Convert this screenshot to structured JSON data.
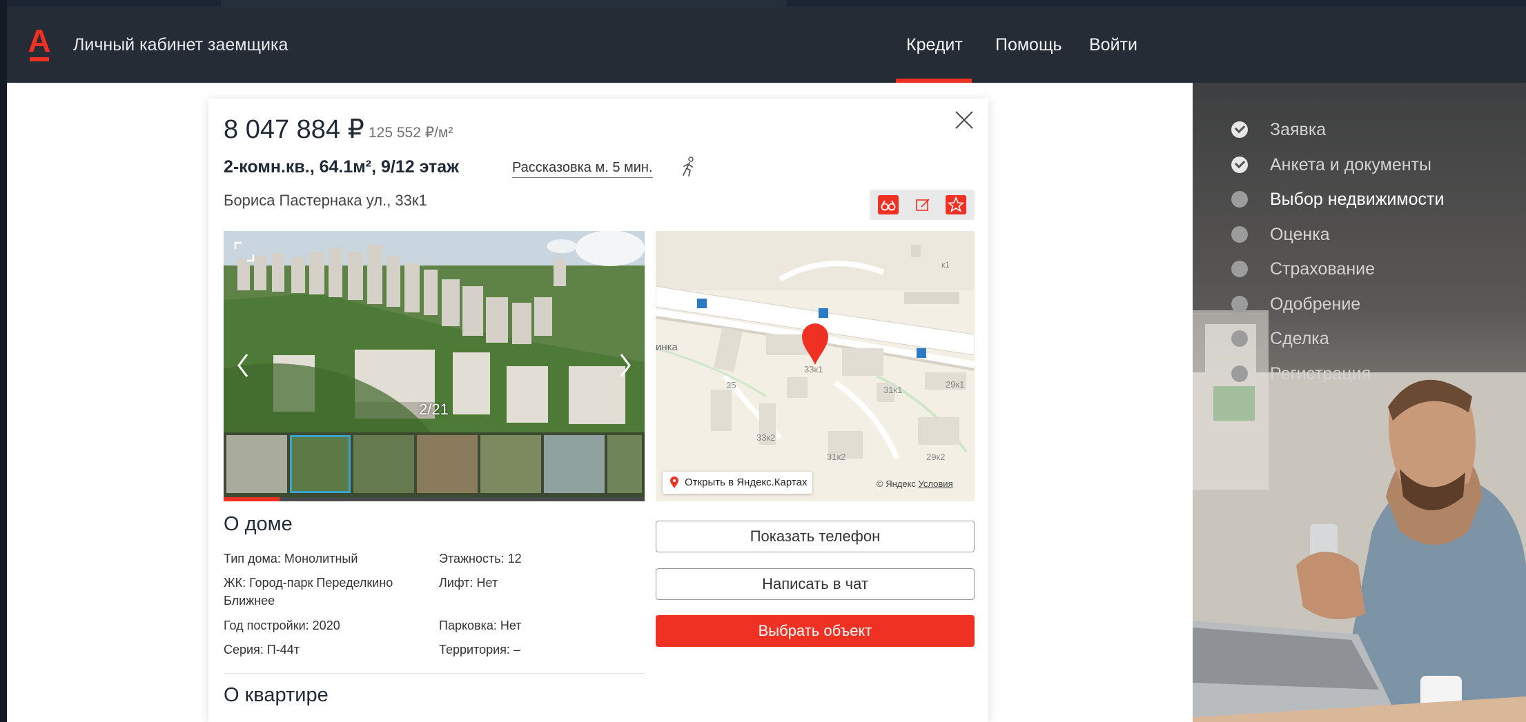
{
  "header": {
    "logo_letter": "А",
    "title": "Личный кабинет заемщика",
    "nav": [
      {
        "label": "Кредит",
        "active": true
      },
      {
        "label": "Помощь",
        "active": false
      },
      {
        "label": "Войти",
        "active": false
      }
    ]
  },
  "steps": [
    {
      "label": "Заявка",
      "status": "done"
    },
    {
      "label": "Анкета и документы",
      "status": "done"
    },
    {
      "label": "Выбор недвижимости",
      "status": "current"
    },
    {
      "label": "Оценка",
      "status": "pending"
    },
    {
      "label": "Страхование",
      "status": "pending"
    },
    {
      "label": "Одобрение",
      "status": "pending"
    },
    {
      "label": "Сделка",
      "status": "pending"
    },
    {
      "label": "Регистрация",
      "status": "pending"
    }
  ],
  "listing": {
    "price": "8 047 884 ₽",
    "price_per_m2": "125 552 ₽/м²",
    "title": "2-комн.кв., 64.1м², 9/12 этаж",
    "metro": "Рассказовка м. 5 мин.",
    "address": "Бориса Пастернака ул., 33к1",
    "gallery": {
      "counter": "2/21",
      "position": 2,
      "total": 21,
      "thumbs": 7,
      "selected_thumb": 1
    },
    "map": {
      "open_link": "Открыть в Яндекс.Картах",
      "credit": "© Яндекс",
      "terms": "Условия",
      "labels": {
        "pin": "33к1",
        "b1": "35",
        "b2": "31к1",
        "b3": "29к1",
        "b4": "33к2",
        "b5": "31к2",
        "b6": "29к2",
        "b7": "к1",
        "street": "инка"
      }
    }
  },
  "house": {
    "title": "О доме",
    "left": [
      "Тип дома: Монолитный",
      "ЖК: Город-парк Переделкино Ближнее",
      "Год постройки: 2020",
      "Серия: П-44т"
    ],
    "right": [
      "Этажность: 12",
      "Лифт: Нет",
      "Парковка: Нет",
      "Территория: –"
    ]
  },
  "apartment": {
    "title": "О квартире"
  },
  "buttons": {
    "show_phone": "Показать телефон",
    "chat": "Написать в чат",
    "select": "Выбрать объект"
  },
  "colors": {
    "accent": "#ef3124",
    "header": "#262c36",
    "text": "#1f2a36"
  }
}
